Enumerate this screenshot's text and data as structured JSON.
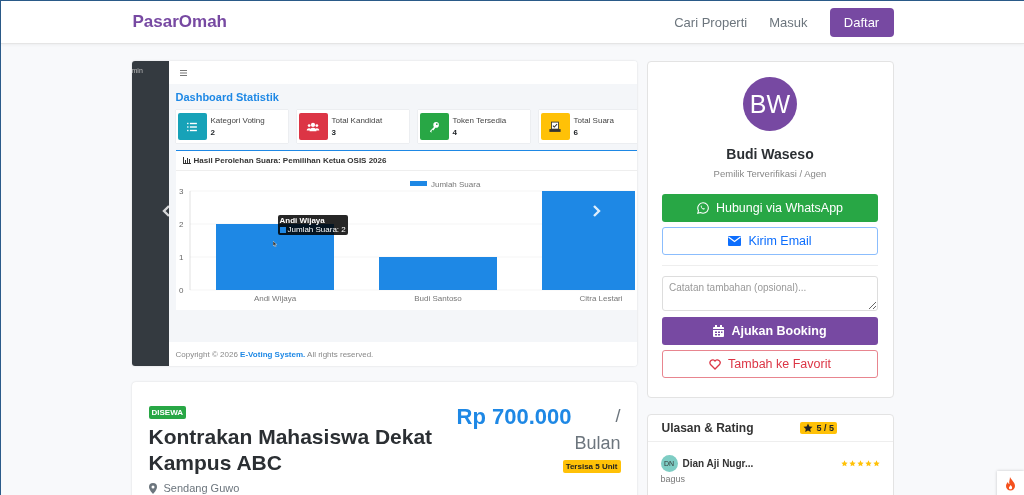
{
  "navbar": {
    "brand": "PasarOmah",
    "links": [
      {
        "label": "Cari Properti"
      },
      {
        "label": "Masuk"
      }
    ],
    "register_button": "Daftar"
  },
  "gallery": {
    "screenshot": {
      "sidebar_text": "min",
      "page_title": "Dashboard Statistik",
      "stats": [
        {
          "label": "Kategori Voting",
          "value": "2",
          "color": "#17a2b8",
          "kind": "list"
        },
        {
          "label": "Total Kandidat",
          "value": "3",
          "color": "#dc3545",
          "kind": "users"
        },
        {
          "label": "Token Tersedia",
          "value": "4",
          "color": "#28a745",
          "kind": "key"
        },
        {
          "label": "Total Suara",
          "value": "6",
          "color": "#ffc107",
          "kind": "ballot"
        }
      ],
      "chart_title": "Hasil Perolehan Suara: Pemilihan Ketua OSIS 2026",
      "chart_data": {
        "type": "bar",
        "categories": [
          "Andi Wijaya",
          "Budi Santoso",
          "Citra Lestari"
        ],
        "series": [
          {
            "name": "Jumlah Suara",
            "color": "#1e88e5",
            "values": [
              2,
              1,
              3
            ]
          }
        ],
        "ylim": [
          0,
          3
        ],
        "yticks": [
          0,
          1,
          2,
          3
        ]
      },
      "tooltip": {
        "title": "Andi Wijaya",
        "body": "Jumlah Suara: 2"
      },
      "footer": {
        "prefix": "Copyright © 2026",
        "link": "E-Voting System.",
        "suffix": "All rights reserved."
      }
    }
  },
  "listing": {
    "status_badge": "DISEWA",
    "title": "Kontrakan Mahasiswa Dekat Kampus ABC",
    "price": "Rp 700.000",
    "price_unit": "/ Bulan",
    "availability_badge": "Tersisa 5 Unit",
    "location": "Sendang Guwo"
  },
  "owner": {
    "initials": "BW",
    "name": "Budi Waseso",
    "role": "Pemilik Terverifikasi / Agen",
    "whatsapp_button": "Hubungi via WhatsApp",
    "email_button": "Kirim Email",
    "note_placeholder": "Catatan tambahan (opsional)...",
    "booking_button": "Ajukan Booking",
    "favorite_button": "Tambah ke Favorit"
  },
  "reviews": {
    "title": "Ulasan & Rating",
    "rating_badge": "5 / 5",
    "items": [
      {
        "initials": "DN",
        "name": "Dian Aji Nugr...",
        "stars": 5,
        "comment": "bagus"
      }
    ]
  }
}
